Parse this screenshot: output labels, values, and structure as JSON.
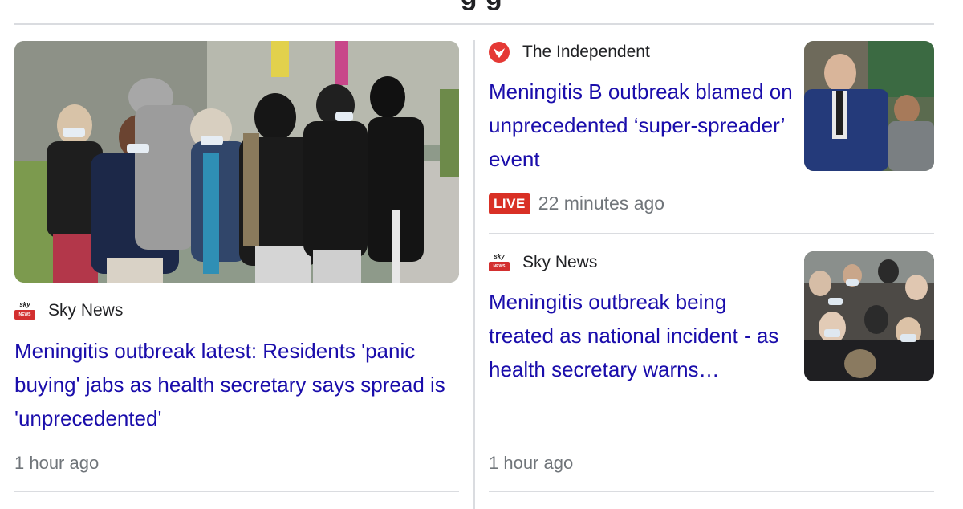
{
  "page": {
    "heading_fragment": "g          g"
  },
  "left_card": {
    "image_name": "queue-of-people-wearing-masks-photo",
    "source": "Sky News",
    "headline": "Meningitis outbreak latest: Residents 'panic buying' jabs as health secretary says spread is 'unprecedented'",
    "time": "1 hour ago"
  },
  "right_cards": [
    {
      "source": "The Independent",
      "headline": "Meningitis B outbreak blamed on unprecedented ‘super-spreader’ event",
      "live_label": "LIVE",
      "time": "22 minutes ago",
      "image_name": "parliament-speaker-photo"
    },
    {
      "source": "Sky News",
      "headline": "Meningitis outbreak being treated as national incident - as health secretary warns…",
      "time": "1 hour ago",
      "image_name": "crowd-with-masks-photo"
    }
  ],
  "colors": {
    "link": "#1a0dab",
    "meta": "#70757a",
    "divider": "#dadce0",
    "live_red": "#d93025"
  }
}
